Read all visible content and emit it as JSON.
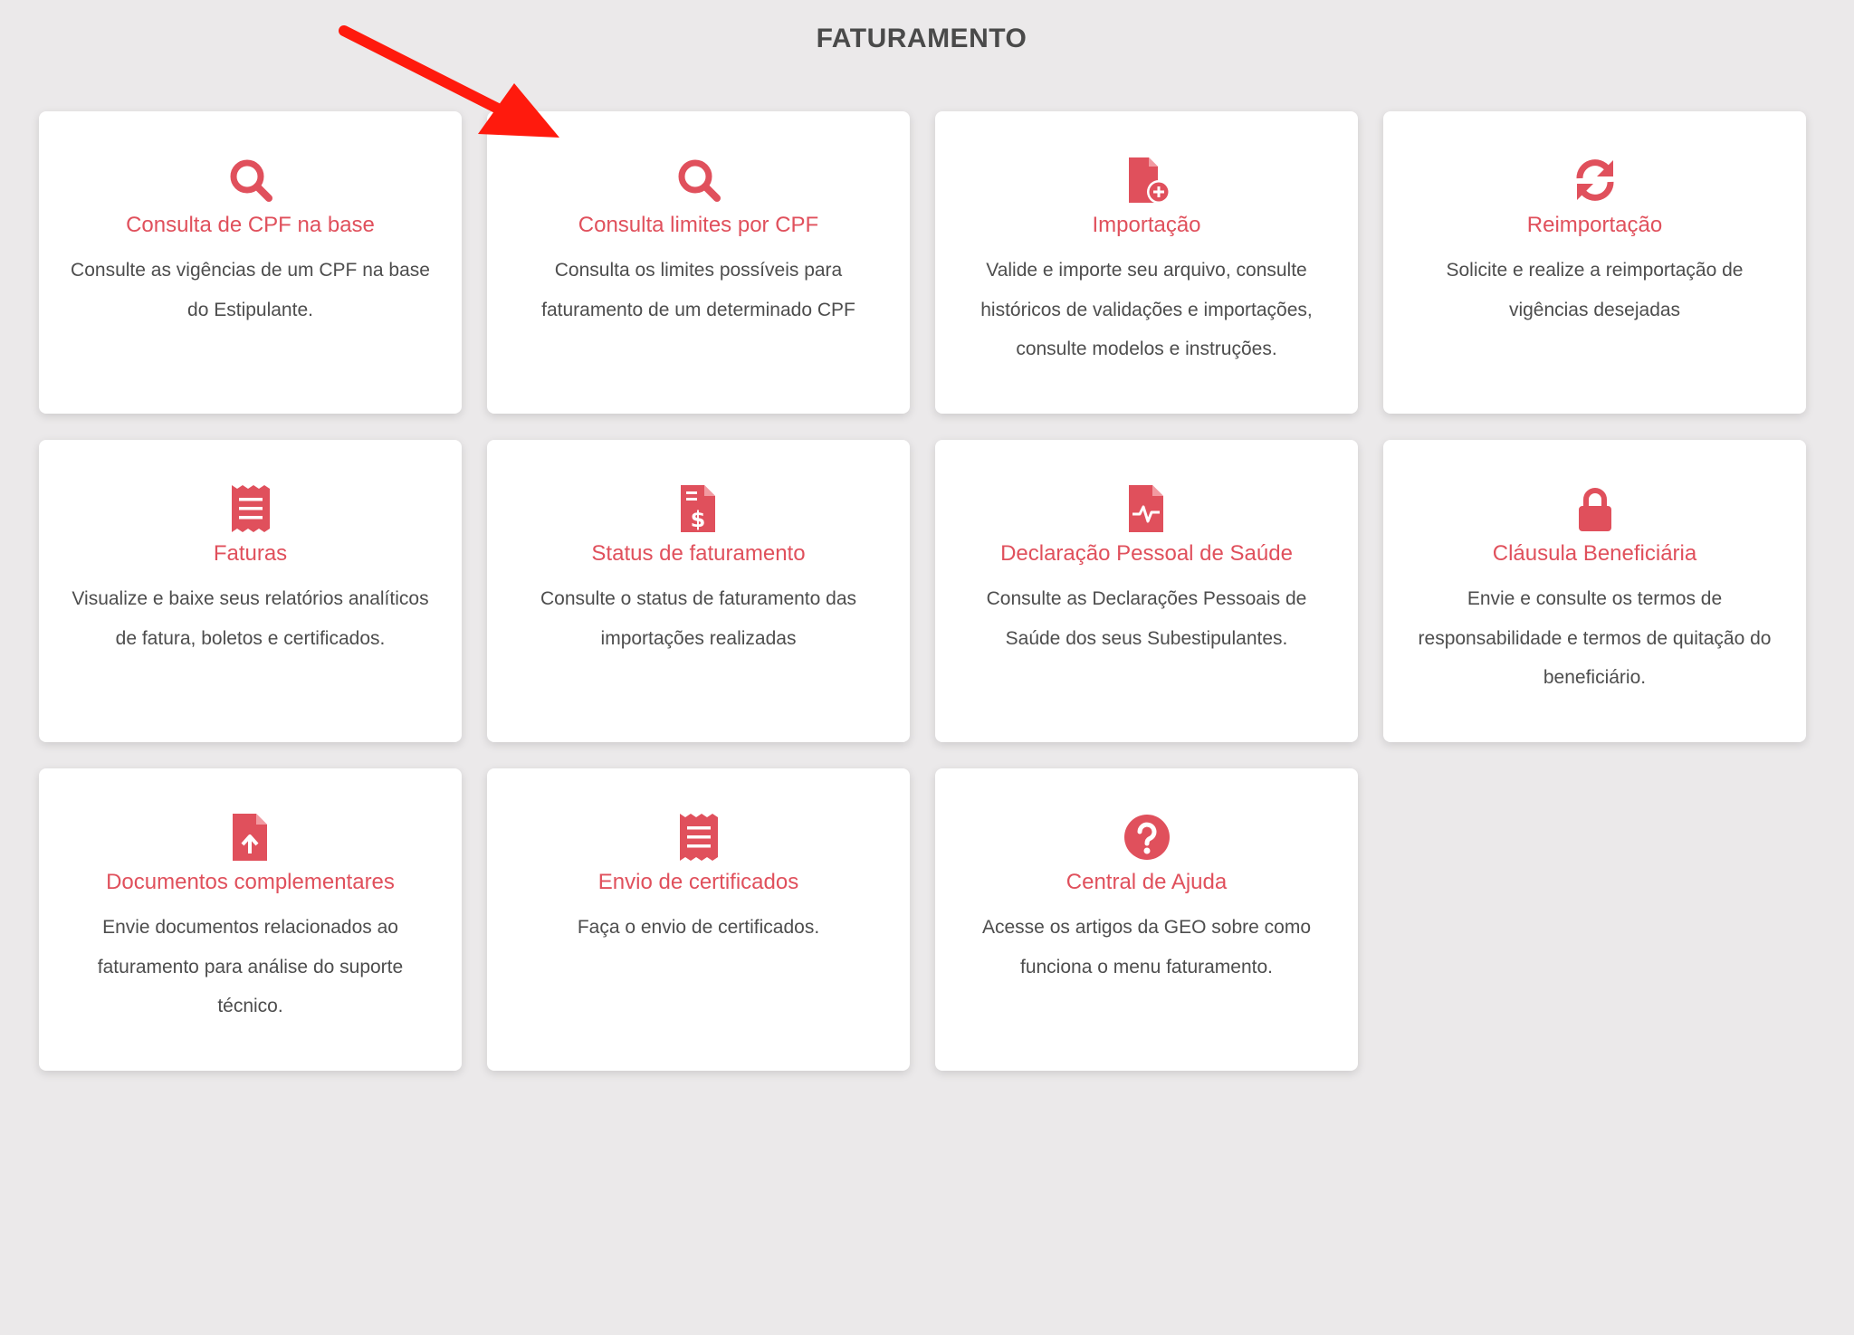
{
  "page": {
    "title": "FATURAMENTO"
  },
  "colors": {
    "accent": "#e0505c",
    "background": "#ebe9ea",
    "card": "#ffffff",
    "text": "#4d4d4d",
    "annotation_arrow": "#ff1a0d"
  },
  "cards": [
    {
      "icon": "search-icon",
      "title": "Consulta de CPF na base",
      "description": "Consulte as vigências de um CPF na base do Estipulante."
    },
    {
      "icon": "search-icon",
      "title": "Consulta limites por CPF",
      "description": "Consulta os limites possíveis para faturamento de um determinado CPF"
    },
    {
      "icon": "file-plus-icon",
      "title": "Importação",
      "description": "Valide e importe seu arquivo, consulte históricos de validações e importações, consulte modelos e instruções."
    },
    {
      "icon": "sync-icon",
      "title": "Reimportação",
      "description": "Solicite e realize a reimportação de vigências desejadas"
    },
    {
      "icon": "receipt-icon",
      "title": "Faturas",
      "description": "Visualize e baixe seus relatórios analíticos de fatura, boletos e certificados."
    },
    {
      "icon": "file-invoice-dollar-icon",
      "title": "Status de faturamento",
      "description": "Consulte o status de faturamento das importações realizadas"
    },
    {
      "icon": "file-medical-icon",
      "title": "Declaração Pessoal de Saúde",
      "description": "Consulte as Declarações Pessoais de Saúde dos seus Subestipulantes."
    },
    {
      "icon": "lock-icon",
      "title": "Cláusula Beneficiária",
      "description": "Envie e consulte os termos de responsabilidade e termos de quitação do beneficiário."
    },
    {
      "icon": "file-upload-icon",
      "title": "Documentos complementares",
      "description": "Envie documentos relacionados ao faturamento para análise do suporte técnico."
    },
    {
      "icon": "receipt-icon",
      "title": "Envio de certificados",
      "description": "Faça o envio de certificados."
    },
    {
      "icon": "question-circle-icon",
      "title": "Central de Ajuda",
      "description": "Acesse os artigos da GEO sobre como funciona o menu faturamento."
    }
  ]
}
